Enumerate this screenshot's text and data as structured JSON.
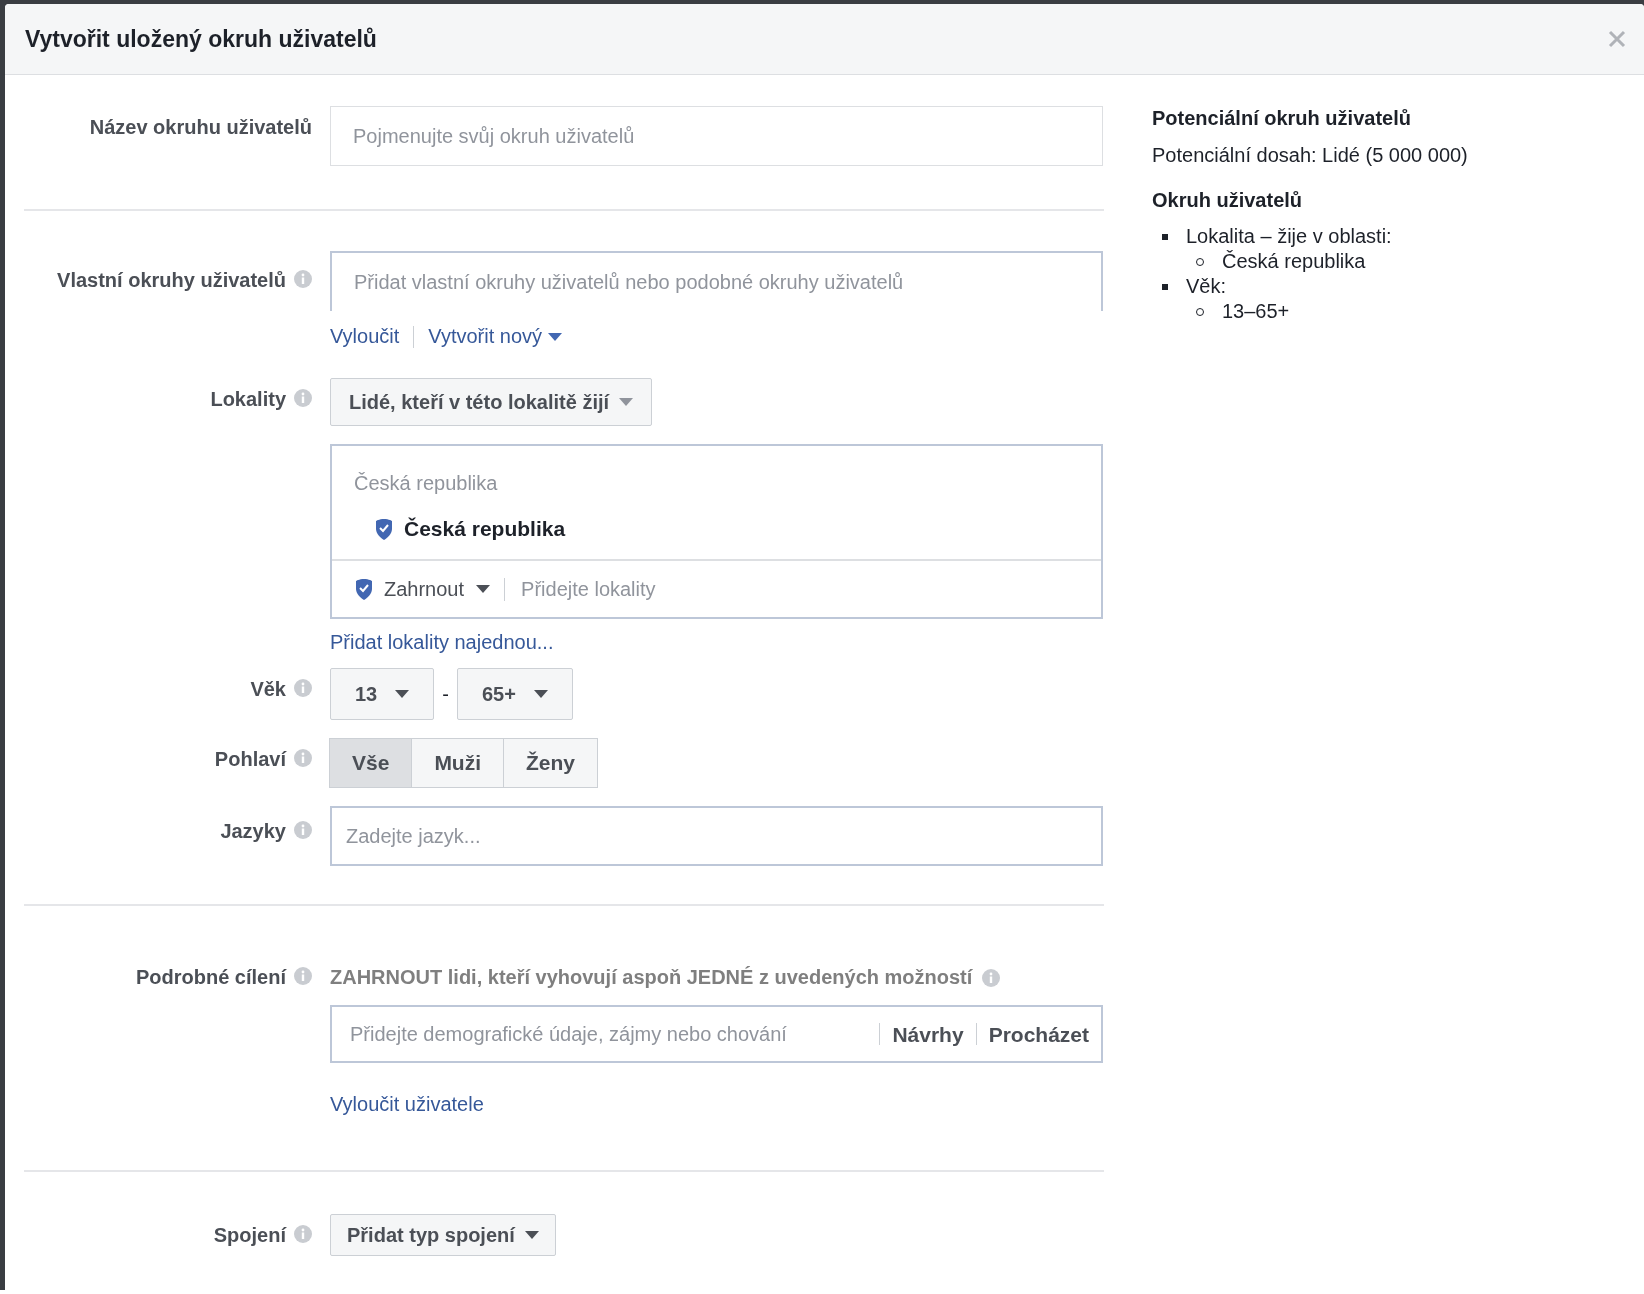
{
  "dialog": {
    "title": "Vytvořit uložený okruh uživatelů"
  },
  "form": {
    "name": {
      "label": "Název okruhu uživatelů",
      "info": false,
      "placeholder": "Pojmenujte svůj okruh uživatelů"
    },
    "custom_audiences": {
      "label": "Vlastní okruhy uživatelů",
      "info": true,
      "placeholder": "Přidat vlastní okruhy uživatelů nebo podobné okruhy uživatelů",
      "links": [
        {
          "label": "Vyloučit",
          "caret": false
        },
        {
          "label": "Vytvořit nový",
          "caret": true
        }
      ]
    },
    "locations": {
      "label": "Lokality",
      "info": true,
      "mode": "Lidé, kteří v této lokalitě žijí",
      "group_label": "Česká republika",
      "selected": [
        {
          "name": "Česká republika"
        }
      ],
      "filter": "Zahrnout",
      "placeholder": "Přidejte lokality",
      "bulk_link": "Přidat lokality najednou..."
    },
    "age": {
      "label": "Věk",
      "info": true,
      "min": "13",
      "separator": "-",
      "max": "65+"
    },
    "gender": {
      "label": "Pohlaví",
      "info": true,
      "options": [
        {
          "label": "Vše",
          "selected": true
        },
        {
          "label": "Muži",
          "selected": false
        },
        {
          "label": "Ženy",
          "selected": false
        }
      ]
    },
    "languages": {
      "label": "Jazyky",
      "info": true,
      "placeholder": "Zadejte jazyk..."
    },
    "detailed_targeting": {
      "label": "Podrobné cílení",
      "info": true,
      "heading": "ZAHRNOUT lidi, kteří vyhovují aspoň JEDNÉ z uvedených možností",
      "placeholder": "Přidejte demografické údaje, zájmy nebo chování",
      "actions": [
        "Návrhy",
        "Procházet"
      ],
      "exclude_link": "Vyloučit uživatele"
    },
    "connections": {
      "label": "Spojení",
      "info": true,
      "button": "Přidat typ spojení"
    }
  },
  "summary": {
    "title": "Potenciální okruh uživatelů",
    "reach": "Potenciální dosah: Lidé (5 000 000)",
    "audience_title": "Okruh uživatelů",
    "items": [
      {
        "label": "Lokalita – žije v oblasti:",
        "children": [
          {
            "label": "Česká republika"
          }
        ]
      },
      {
        "label": "Věk:",
        "children": [
          {
            "label": "13–65+"
          }
        ]
      }
    ]
  }
}
